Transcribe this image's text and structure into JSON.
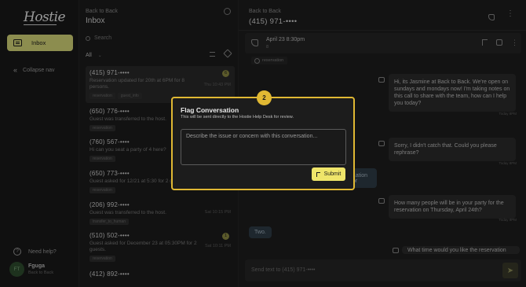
{
  "sidebar": {
    "logo": "Hostie",
    "nav_inbox": "Inbox",
    "collapse": "Collapse nav",
    "help": "Need help?",
    "user": {
      "initials": "FT",
      "name": "Fguga",
      "org": "Back to Back"
    }
  },
  "inbox": {
    "subtitle": "Back to Back",
    "title": "Inbox",
    "search_placeholder": "Search",
    "filter": "All",
    "conversations": [
      {
        "phone": "(415) 971-••••",
        "msg": "Reservation updated for 20th at 6PM for 8 persons.",
        "time": "Thu 10:43 PM",
        "badge": "6",
        "tags": [
          "reservation",
          "guest_info"
        ]
      },
      {
        "phone": "(650) 776-••••",
        "msg": "Guest was transferred to the host.",
        "time": "",
        "badge": "",
        "tags": [
          "reservation"
        ]
      },
      {
        "phone": "(760) 567-••••",
        "msg": "Hi can you seat a party of 4 here?",
        "time": "",
        "badge": "",
        "tags": [
          "reservation"
        ]
      },
      {
        "phone": "(650) 773-••••",
        "msg": "Guest asked for 12/21 at 5:30 for 2 guests.",
        "time": "",
        "badge": "",
        "tags": [
          "reservation"
        ]
      },
      {
        "phone": "(206) 992-••••",
        "msg": "Guest was transferred to the host.",
        "time": "Sat 10:15 PM",
        "badge": "",
        "tags": [
          "transfer_to_human"
        ]
      },
      {
        "phone": "(510) 502-••••",
        "msg": "Guest asked for December 23 at 05:30PM for 2 guests.",
        "time": "Sat 10:11 PM",
        "badge": "1",
        "tags": [
          "reservation"
        ]
      },
      {
        "phone": "(412) 892-••••",
        "msg": "",
        "time": "",
        "badge": "",
        "tags": []
      }
    ]
  },
  "chat": {
    "subtitle": "Back to Back",
    "phone": "(415) 971-••••",
    "res_date": "April 23 8:30pm",
    "res_party": "8",
    "res_tag": "reservation",
    "messages": [
      {
        "text": "Hi, its Jasmine at Back to Back. We're open on sundays and mondays now! I'm taking notes on this call to share with the team, how can I help you today?",
        "time": "Today 8PM"
      },
      {
        "text": "Sorry, I didn't catch that. Could you please rephrase?",
        "time": "Today 8PM"
      },
      {
        "text": "How many people will be in your party for the reservation on Thursday, April 24th?",
        "time": "Today 8PM"
      },
      {
        "text": "What time would you like the reservation for?",
        "time": ""
      }
    ],
    "user_msgs": [
      "...ation for",
      "Two."
    ],
    "composer_placeholder": "Send text to (415) 971-••••"
  },
  "modal": {
    "step": "2",
    "title": "Flag Conversation",
    "description": "This will be sent directly to the Hostie Help Desk for review.",
    "input_placeholder": "Describe the issue or concern with this conversation...",
    "submit": "Submit"
  },
  "colors": {
    "accent": "#e0b833",
    "submit": "#efe56a",
    "nav_active": "#d8d97a"
  }
}
